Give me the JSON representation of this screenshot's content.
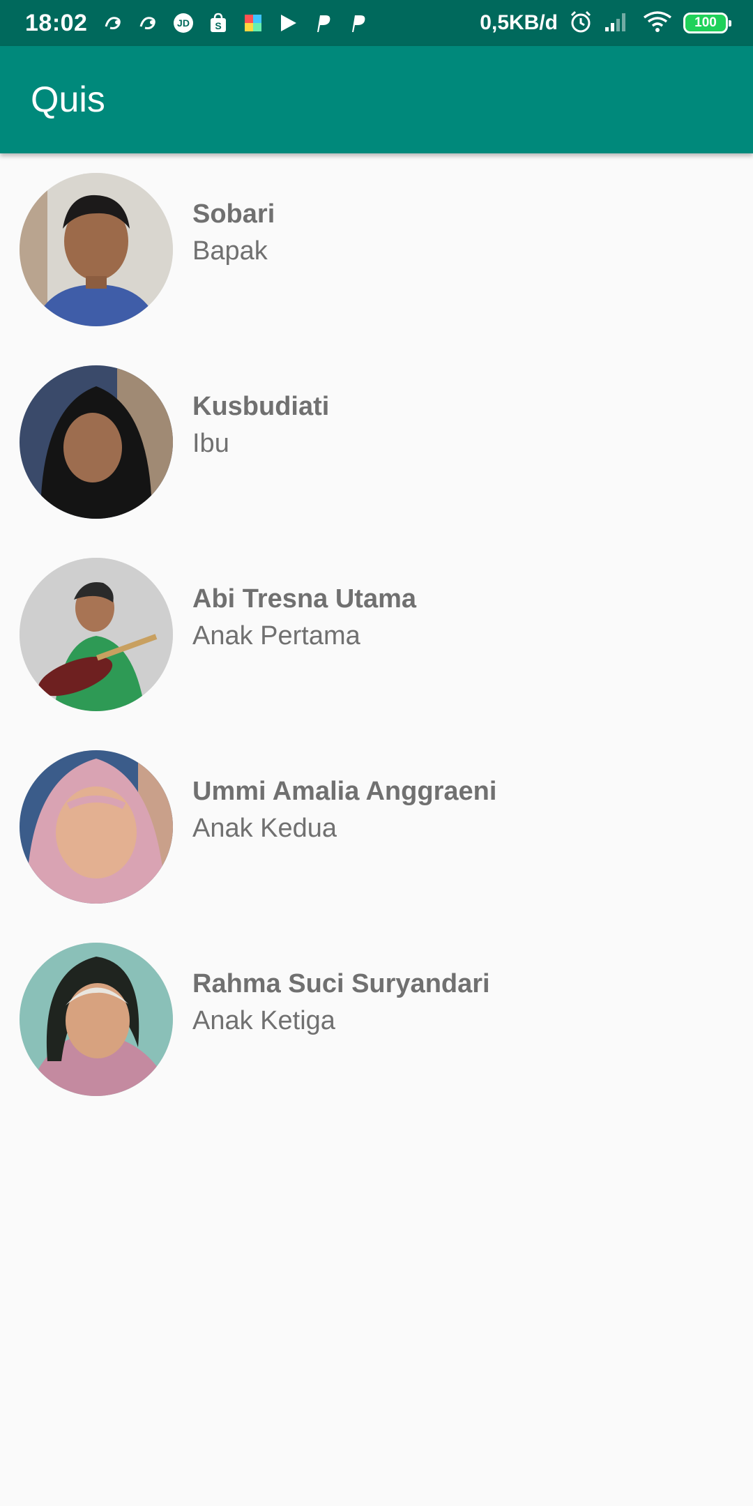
{
  "status_bar": {
    "time": "18:02",
    "notification_icons": [
      "uc-browser-icon",
      "uc-browser-icon",
      "jd-icon",
      "shopee-icon",
      "photos-icon",
      "play-icon",
      "p-icon",
      "p-icon"
    ],
    "network_speed": "0,5KB/d",
    "battery": "100"
  },
  "app_bar": {
    "title": "Quis"
  },
  "people": [
    {
      "name": "Sobari",
      "role": "Bapak"
    },
    {
      "name": "Kusbudiati",
      "role": "Ibu"
    },
    {
      "name": "Abi Tresna Utama",
      "role": "Anak Pertama"
    },
    {
      "name": "Ummi Amalia Anggraeni",
      "role": "Anak Kedua"
    },
    {
      "name": "Rahma Suci Suryandari",
      "role": "Anak Ketiga"
    }
  ],
  "colors": {
    "status_bar": "#00695c",
    "app_bar": "#00897b",
    "text": "#707070",
    "background": "#fafafa"
  }
}
